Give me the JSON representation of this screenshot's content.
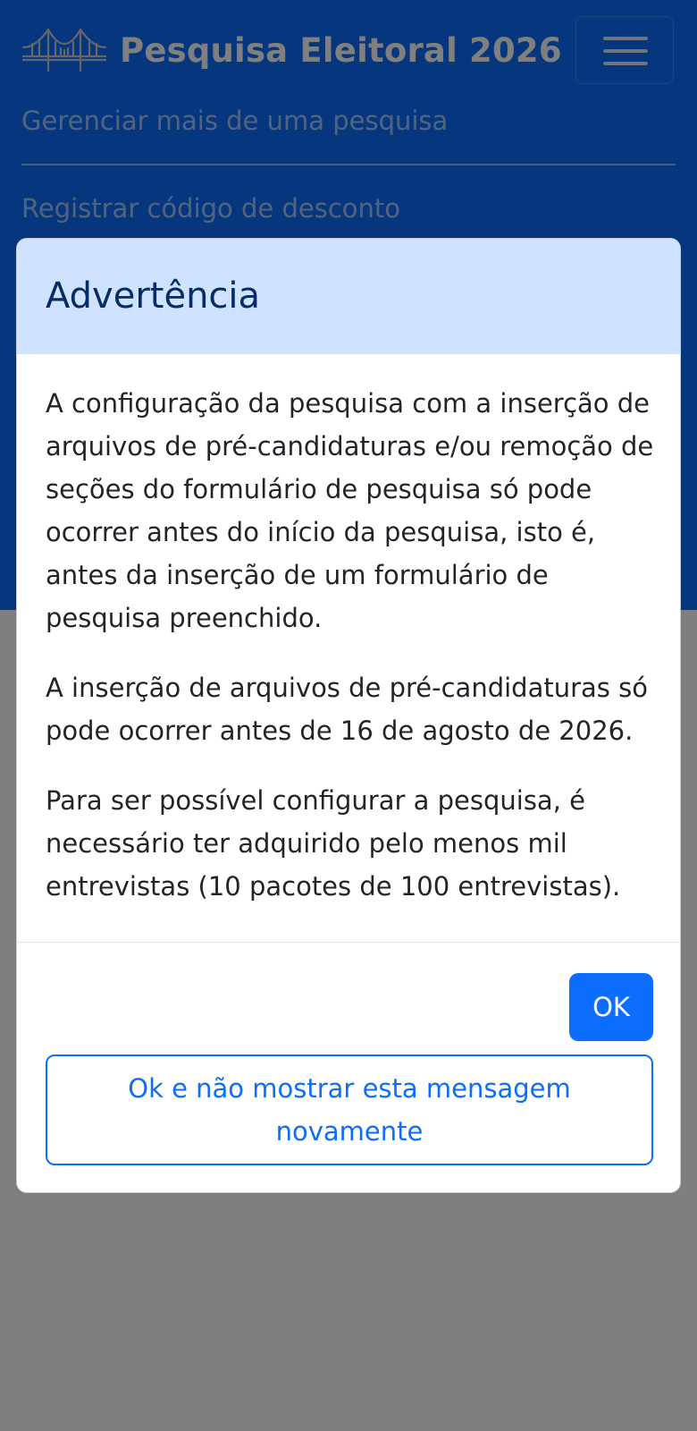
{
  "navbar": {
    "brand_title": "Pesquisa Eleitoral 2026",
    "brand_icon": "bridge-icon",
    "menu_icon": "hamburger-menu-icon",
    "links": [
      {
        "label": "Gerenciar mais de uma pesquisa"
      },
      {
        "label": "Registrar código de desconto"
      }
    ],
    "colors": {
      "background": "#0d6efd"
    }
  },
  "modal": {
    "title": "Advertência",
    "paragraphs": [
      "A configuração da pesquisa com a inserção de arquivos de pré-candidaturas e/ou remoção de seções do formulário de pesquisa só pode ocorrer antes do início da pesquisa, isto é, antes da inserção de um formulário de pesquisa preenchido.",
      "A inserção de arquivos de pré-candidaturas só pode ocorrer antes de 16 de agosto de 2026.",
      "Para ser possível configurar a pesquisa, é necessário ter adquirido pelo menos mil entrevistas (10 pacotes de 100 entrevistas)."
    ],
    "ok_label": "OK",
    "dismiss_label": "Ok e não mostrar esta mensagem novamente",
    "colors": {
      "header_bg": "#cfe2ff",
      "title": "#052c65",
      "primary": "#0d6efd"
    }
  }
}
